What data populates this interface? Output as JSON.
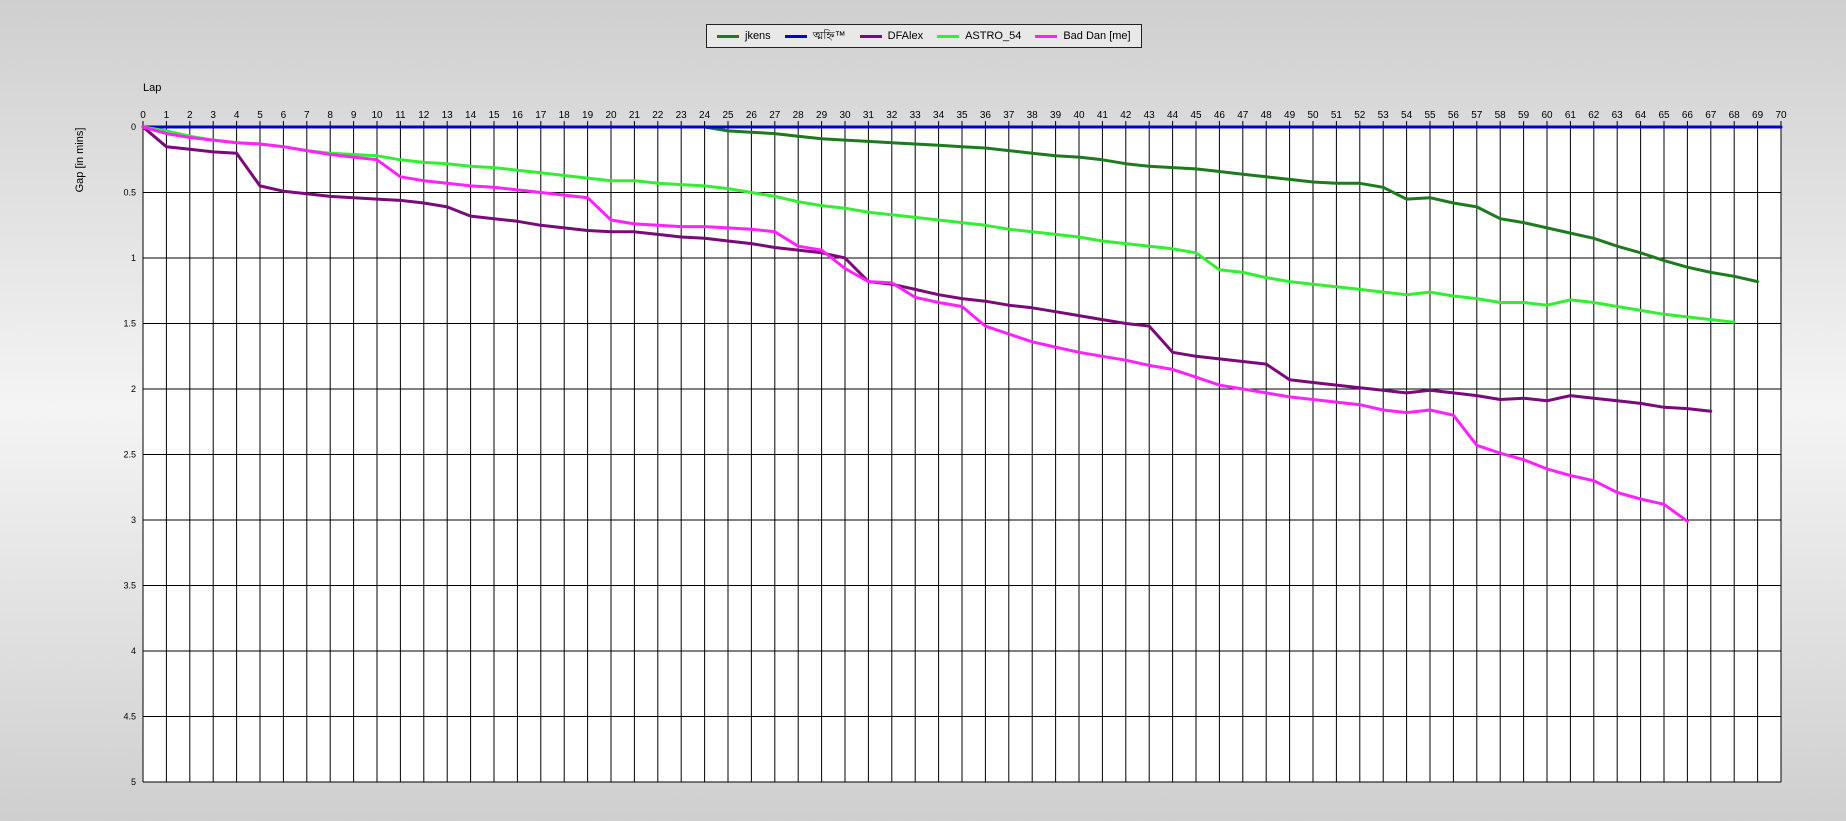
{
  "chart_data": {
    "type": "line",
    "xlabel": "Lap",
    "ylabel": "Gap [in mins]",
    "xlim": [
      0,
      70
    ],
    "ylim": [
      0,
      5
    ],
    "y_inverted": true,
    "grid": true,
    "legend_position": "top-center",
    "x_ticks": [
      0,
      1,
      2,
      3,
      4,
      5,
      6,
      7,
      8,
      9,
      10,
      11,
      12,
      13,
      14,
      15,
      16,
      17,
      18,
      19,
      20,
      21,
      22,
      23,
      24,
      25,
      26,
      27,
      28,
      29,
      30,
      31,
      32,
      33,
      34,
      35,
      36,
      37,
      38,
      39,
      40,
      41,
      42,
      43,
      44,
      45,
      46,
      47,
      48,
      49,
      50,
      51,
      52,
      53,
      54,
      55,
      56,
      57,
      58,
      59,
      60,
      61,
      62,
      63,
      64,
      65,
      66,
      67,
      68,
      69,
      70
    ],
    "y_ticks": [
      0,
      0.5,
      1,
      1.5,
      2,
      2.5,
      3,
      3.5,
      4,
      4.5,
      5
    ],
    "y_tick_labels": [
      "0",
      "0.5",
      "1",
      "1.5",
      "2",
      "2.5",
      "3",
      "3.5",
      "4",
      "4.5",
      "5"
    ],
    "series": [
      {
        "name": "jkens",
        "color": "#1e7a1e",
        "values": [
          0,
          0,
          0,
          0,
          0,
          0,
          0,
          0,
          0,
          0,
          0,
          0,
          0,
          0,
          0,
          0,
          0,
          0,
          0,
          0,
          0,
          0,
          0,
          0,
          0,
          0.03,
          0.04,
          0.05,
          0.07,
          0.09,
          0.1,
          0.11,
          0.12,
          0.13,
          0.14,
          0.15,
          0.16,
          0.18,
          0.2,
          0.22,
          0.23,
          0.25,
          0.28,
          0.3,
          0.31,
          0.32,
          0.34,
          0.36,
          0.38,
          0.4,
          0.42,
          0.43,
          0.43,
          0.46,
          0.55,
          0.54,
          0.58,
          0.61,
          0.7,
          0.73,
          0.77,
          0.81,
          0.85,
          0.91,
          0.96,
          1.02,
          1.07,
          1.11,
          1.14,
          1.18
        ]
      },
      {
        "name": "ত্মহ্নি™",
        "color": "#0000cc",
        "values": [
          0,
          0,
          0,
          0,
          0,
          0,
          0,
          0,
          0,
          0,
          0,
          0,
          0,
          0,
          0,
          0,
          0,
          0,
          0,
          0,
          0,
          0,
          0,
          0,
          0,
          0,
          0,
          0,
          0,
          0,
          0,
          0,
          0,
          0,
          0,
          0,
          0,
          0,
          0,
          0,
          0,
          0,
          0,
          0,
          0,
          0,
          0,
          0,
          0,
          0,
          0,
          0,
          0,
          0,
          0,
          0,
          0,
          0,
          0,
          0,
          0,
          0,
          0,
          0,
          0,
          0,
          0,
          0,
          0,
          0,
          0
        ]
      },
      {
        "name": "DFAlex",
        "color": "#7a0a7a",
        "values": [
          0,
          0.15,
          0.17,
          0.19,
          0.2,
          0.45,
          0.49,
          0.51,
          0.53,
          0.54,
          0.55,
          0.56,
          0.58,
          0.61,
          0.68,
          0.7,
          0.72,
          0.75,
          0.77,
          0.79,
          0.8,
          0.8,
          0.82,
          0.84,
          0.85,
          0.87,
          0.89,
          0.92,
          0.94,
          0.96,
          1.0,
          1.18,
          1.2,
          1.24,
          1.28,
          1.31,
          1.33,
          1.36,
          1.38,
          1.41,
          1.44,
          1.47,
          1.5,
          1.52,
          1.72,
          1.75,
          1.77,
          1.79,
          1.81,
          1.93,
          1.95,
          1.97,
          1.99,
          2.01,
          2.03,
          2.01,
          2.03,
          2.05,
          2.08,
          2.07,
          2.09,
          2.05,
          2.07,
          2.09,
          2.11,
          2.14,
          2.15,
          2.17
        ]
      },
      {
        "name": "ASTRO_54",
        "color": "#33ee33",
        "values": [
          0,
          0.03,
          0.07,
          0.1,
          0.12,
          0.13,
          0.15,
          0.18,
          0.2,
          0.21,
          0.22,
          0.25,
          0.27,
          0.28,
          0.3,
          0.31,
          0.33,
          0.35,
          0.37,
          0.39,
          0.41,
          0.41,
          0.43,
          0.44,
          0.45,
          0.47,
          0.5,
          0.53,
          0.57,
          0.6,
          0.62,
          0.65,
          0.67,
          0.69,
          0.71,
          0.73,
          0.75,
          0.78,
          0.8,
          0.82,
          0.84,
          0.87,
          0.89,
          0.91,
          0.93,
          0.96,
          1.09,
          1.11,
          1.15,
          1.18,
          1.2,
          1.22,
          1.24,
          1.26,
          1.28,
          1.26,
          1.29,
          1.31,
          1.34,
          1.34,
          1.36,
          1.32,
          1.34,
          1.37,
          1.4,
          1.43,
          1.45,
          1.47,
          1.49
        ]
      },
      {
        "name": "Bad Dan [me]",
        "color": "#ff22ff",
        "values": [
          0,
          0.05,
          0.08,
          0.1,
          0.12,
          0.13,
          0.15,
          0.18,
          0.21,
          0.23,
          0.25,
          0.38,
          0.41,
          0.43,
          0.45,
          0.46,
          0.48,
          0.5,
          0.52,
          0.54,
          0.71,
          0.74,
          0.75,
          0.76,
          0.76,
          0.77,
          0.78,
          0.8,
          0.91,
          0.94,
          1.08,
          1.18,
          1.19,
          1.3,
          1.34,
          1.37,
          1.52,
          1.58,
          1.64,
          1.68,
          1.72,
          1.75,
          1.78,
          1.82,
          1.85,
          1.91,
          1.97,
          2.0,
          2.03,
          2.06,
          2.08,
          2.1,
          2.12,
          2.16,
          2.18,
          2.16,
          2.2,
          2.43,
          2.49,
          2.54,
          2.61,
          2.66,
          2.7,
          2.79,
          2.84,
          2.88,
          3.01
        ]
      }
    ]
  }
}
